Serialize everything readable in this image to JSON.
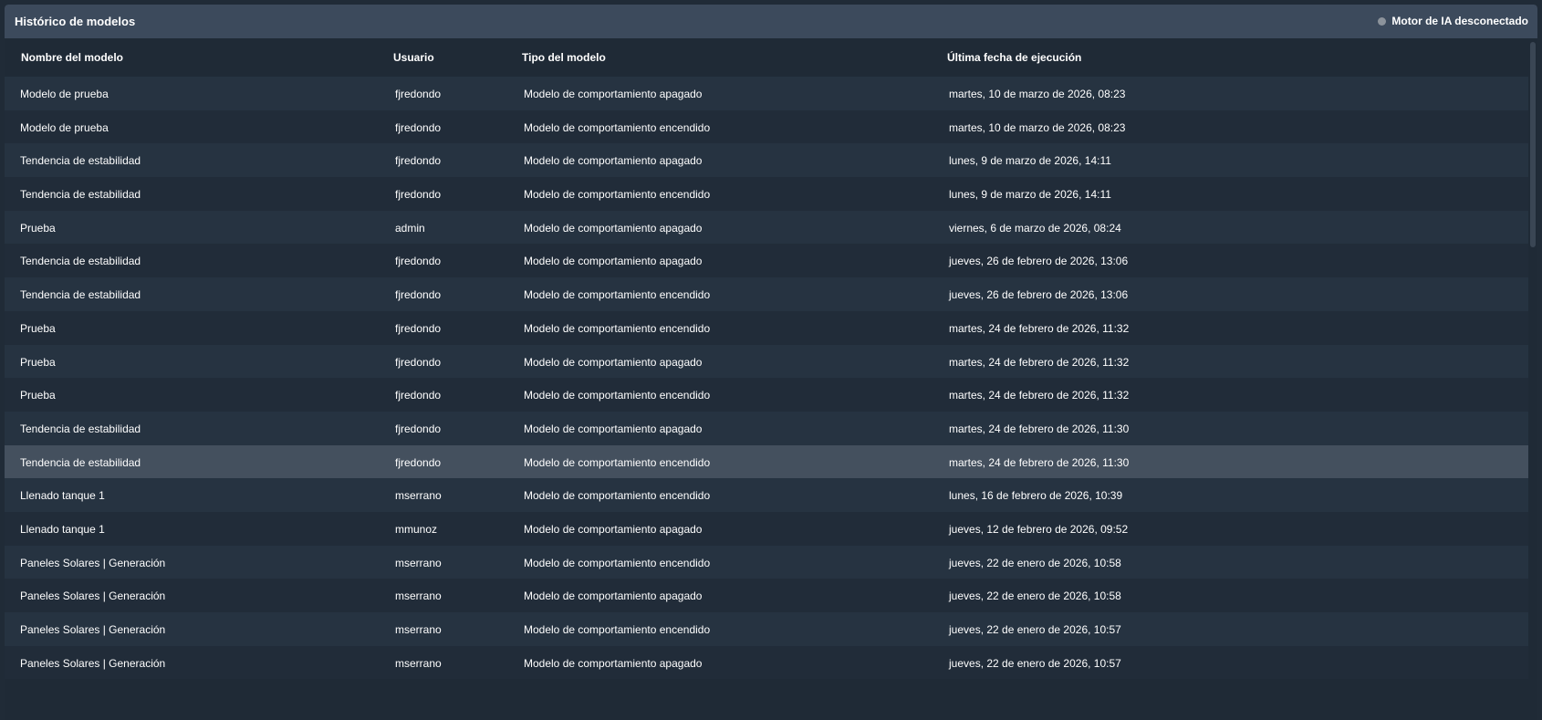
{
  "panel": {
    "title": "Histórico de modelos",
    "status_text": "Motor de IA desconectado",
    "status_color": "#8c939b"
  },
  "table": {
    "columns": [
      "Nombre del modelo",
      "Usuario",
      "Tipo del modelo",
      "Última fecha de ejecución"
    ],
    "selected_row": 11,
    "rows": [
      {
        "name": "Modelo de prueba",
        "user": "fjredondo",
        "type": "Modelo de comportamiento apagado",
        "date": "martes, 10 de marzo de 2026, 08:23"
      },
      {
        "name": "Modelo de prueba",
        "user": "fjredondo",
        "type": "Modelo de comportamiento encendido",
        "date": "martes, 10 de marzo de 2026, 08:23"
      },
      {
        "name": "Tendencia de estabilidad",
        "user": "fjredondo",
        "type": "Modelo de comportamiento apagado",
        "date": "lunes, 9 de marzo de 2026, 14:11"
      },
      {
        "name": "Tendencia de estabilidad",
        "user": "fjredondo",
        "type": "Modelo de comportamiento encendido",
        "date": "lunes, 9 de marzo de 2026, 14:11"
      },
      {
        "name": "Prueba",
        "user": "admin",
        "type": "Modelo de comportamiento apagado",
        "date": "viernes, 6 de marzo de 2026, 08:24"
      },
      {
        "name": "Tendencia de estabilidad",
        "user": "fjredondo",
        "type": "Modelo de comportamiento apagado",
        "date": "jueves, 26 de febrero de 2026, 13:06"
      },
      {
        "name": "Tendencia de estabilidad",
        "user": "fjredondo",
        "type": "Modelo de comportamiento encendido",
        "date": "jueves, 26 de febrero de 2026, 13:06"
      },
      {
        "name": "Prueba",
        "user": "fjredondo",
        "type": "Modelo de comportamiento encendido",
        "date": "martes, 24 de febrero de 2026, 11:32"
      },
      {
        "name": "Prueba",
        "user": "fjredondo",
        "type": "Modelo de comportamiento apagado",
        "date": "martes, 24 de febrero de 2026, 11:32"
      },
      {
        "name": "Prueba",
        "user": "fjredondo",
        "type": "Modelo de comportamiento encendido",
        "date": "martes, 24 de febrero de 2026, 11:32"
      },
      {
        "name": "Tendencia de estabilidad",
        "user": "fjredondo",
        "type": "Modelo de comportamiento apagado",
        "date": "martes, 24 de febrero de 2026, 11:30"
      },
      {
        "name": "Tendencia de estabilidad",
        "user": "fjredondo",
        "type": "Modelo de comportamiento encendido",
        "date": "martes, 24 de febrero de 2026, 11:30"
      },
      {
        "name": "Llenado tanque 1",
        "user": "mserrano",
        "type": "Modelo de comportamiento encendido",
        "date": "lunes, 16 de febrero de 2026, 10:39"
      },
      {
        "name": "Llenado tanque 1",
        "user": "mmunoz",
        "type": "Modelo de comportamiento apagado",
        "date": "jueves, 12 de febrero de 2026, 09:52"
      },
      {
        "name": "Paneles Solares | Generación",
        "user": "mserrano",
        "type": "Modelo de comportamiento encendido",
        "date": "jueves, 22 de enero de 2026, 10:58"
      },
      {
        "name": "Paneles Solares | Generación",
        "user": "mserrano",
        "type": "Modelo de comportamiento apagado",
        "date": "jueves, 22 de enero de 2026, 10:58"
      },
      {
        "name": "Paneles Solares | Generación",
        "user": "mserrano",
        "type": "Modelo de comportamiento encendido",
        "date": "jueves, 22 de enero de 2026, 10:57"
      },
      {
        "name": "Paneles Solares | Generación",
        "user": "mserrano",
        "type": "Modelo de comportamiento apagado",
        "date": "jueves, 22 de enero de 2026, 10:57"
      }
    ]
  }
}
